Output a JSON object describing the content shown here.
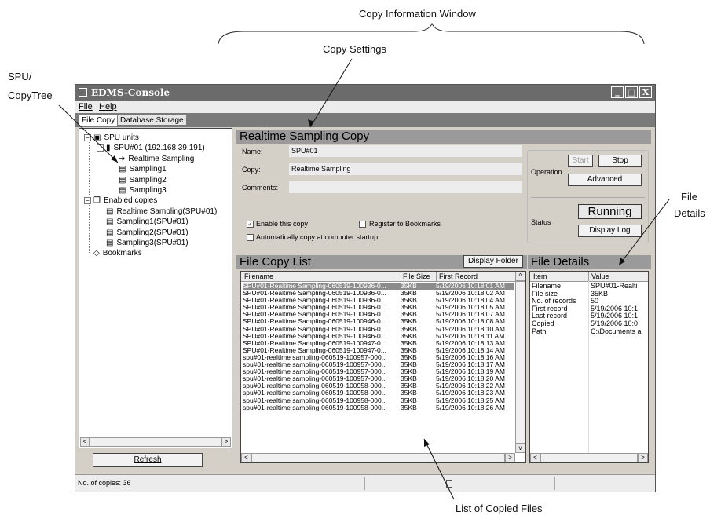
{
  "callouts": {
    "copy_info_window": "Copy Information Window",
    "copy_settings": "Copy Settings",
    "spu_line1": "SPU/",
    "spu_line2": "CopyTree",
    "file_details_line1": "File",
    "file_details_line2": "Details",
    "list_copied": "List of Copied Files"
  },
  "window": {
    "title": "EDMS-Console",
    "menu": [
      "File",
      "Help"
    ],
    "tabs": [
      "File Copy",
      "Database Storage"
    ],
    "controls": [
      "_",
      "□",
      "X"
    ]
  },
  "tree": {
    "items": [
      {
        "label": "SPU units",
        "level": 0,
        "expander": "−",
        "icon": "computer-icon"
      },
      {
        "label": "SPU#01 (192.168.39.191)",
        "level": 1,
        "expander": "−",
        "icon": "server-icon"
      },
      {
        "label": "Realtime Sampling",
        "level": 2,
        "icon": "arrow-icon"
      },
      {
        "label": "Sampling1",
        "level": 2,
        "icon": "document-icon"
      },
      {
        "label": "Sampling2",
        "level": 2,
        "icon": "document-icon"
      },
      {
        "label": "Sampling3",
        "level": 2,
        "icon": "document-icon"
      },
      {
        "label": "Enabled copies",
        "level": 0,
        "expander": "−",
        "icon": "copy-icon"
      },
      {
        "label": "Realtime Sampling(SPU#01)",
        "level": 1,
        "icon": "document-icon"
      },
      {
        "label": "Sampling1(SPU#01)",
        "level": 1,
        "icon": "document-icon"
      },
      {
        "label": "Sampling2(SPU#01)",
        "level": 1,
        "icon": "document-icon"
      },
      {
        "label": "Sampling3(SPU#01)",
        "level": 1,
        "icon": "document-icon"
      },
      {
        "label": "Bookmarks",
        "level": 0,
        "icon": "bookmark-icon"
      }
    ],
    "refresh_label": "Refresh"
  },
  "copy_settings": {
    "title": "Realtime Sampling Copy",
    "name_label": "Name:",
    "name_value": "SPU#01",
    "copy_label": "Copy:",
    "copy_value": "Realtime Sampling",
    "comments_label": "Comments:",
    "comments_value": "",
    "enable_label": "Enable this copy",
    "enable_checked": true,
    "register_label": "Register to Bookmarks",
    "register_checked": false,
    "auto_label": "Automatically copy at computer startup",
    "auto_checked": false
  },
  "operation": {
    "label": "Operation",
    "start": "Start",
    "stop": "Stop",
    "advanced": "Advanced",
    "status_label": "Status",
    "status_value": "Running",
    "display_log": "Display Log"
  },
  "file_list": {
    "title": "File Copy List",
    "display_folder": "Display Folder",
    "columns": [
      "Filename",
      "File Size",
      "First Record"
    ],
    "rows": [
      [
        "SPU#01-Realtime Sampling-060519-100936-0...",
        "35KB",
        "5/19/2006 10:18:01 AM"
      ],
      [
        "SPU#01-Realtime Sampling-060519-100936-0...",
        "35KB",
        "5/19/2006 10:18:02 AM"
      ],
      [
        "SPU#01-Realtime Sampling-060519-100936-0...",
        "35KB",
        "5/19/2006 10:18:04 AM"
      ],
      [
        "SPU#01-Realtime Sampling-060519-100946-0...",
        "35KB",
        "5/19/2006 10:18:05 AM"
      ],
      [
        "SPU#01-Realtime Sampling-060519-100946-0...",
        "35KB",
        "5/19/2006 10:18:07 AM"
      ],
      [
        "SPU#01-Realtime Sampling-060519-100946-0...",
        "35KB",
        "5/19/2006 10:18:08 AM"
      ],
      [
        "SPU#01-Realtime Sampling-060519-100946-0...",
        "35KB",
        "5/19/2006 10:18:10 AM"
      ],
      [
        "SPU#01-Realtime Sampling-060519-100946-0...",
        "35KB",
        "5/19/2006 10:18:11 AM"
      ],
      [
        "SPU#01-Realtime Sampling-060519-100947-0...",
        "35KB",
        "5/19/2006 10:18:13 AM"
      ],
      [
        "SPU#01-Realtime Sampling-060519-100947-0...",
        "35KB",
        "5/19/2006 10:18:14 AM"
      ],
      [
        "spu#01-realtime sampling-060519-100957-000...",
        "35KB",
        "5/19/2006 10:18:16 AM"
      ],
      [
        "spu#01-realtime sampling-060519-100957-000...",
        "35KB",
        "5/19/2006 10:18:17 AM"
      ],
      [
        "spu#01-realtime sampling-060519-100957-000...",
        "35KB",
        "5/19/2006 10:18:19 AM"
      ],
      [
        "spu#01-realtime sampling-060519-100957-000...",
        "35KB",
        "5/19/2006 10:18:20 AM"
      ],
      [
        "spu#01-realtime sampling-060519-100958-000...",
        "35KB",
        "5/19/2006 10:18:22 AM"
      ],
      [
        "spu#01-realtime sampling-060519-100958-000...",
        "35KB",
        "5/19/2006 10:18:23 AM"
      ],
      [
        "spu#01-realtime sampling-060519-100958-000...",
        "35KB",
        "5/19/2006 10:18:25 AM"
      ],
      [
        "spu#01-realtime sampling-060519-100958-000...",
        "35KB",
        "5/19/2006 10:18:26 AM"
      ]
    ]
  },
  "file_details": {
    "title": "File Details",
    "columns": [
      "Item",
      "Value"
    ],
    "rows": [
      [
        "Filename",
        "SPU#01-Realti"
      ],
      [
        "File size",
        "35KB"
      ],
      [
        "No. of records",
        "50"
      ],
      [
        "First record",
        "5/19/2006 10:1"
      ],
      [
        "Last record",
        "5/19/2006 10:1"
      ],
      [
        "Copied",
        "5/19/2006 10:0"
      ],
      [
        "Path",
        "C:\\Documents a"
      ]
    ]
  },
  "statusbar": {
    "text": "No. of copies: 36"
  },
  "colors": {
    "titlebar": "#6b6b6b",
    "section_header": "#9a9a9a",
    "selected_row": "#8c8c8c"
  }
}
